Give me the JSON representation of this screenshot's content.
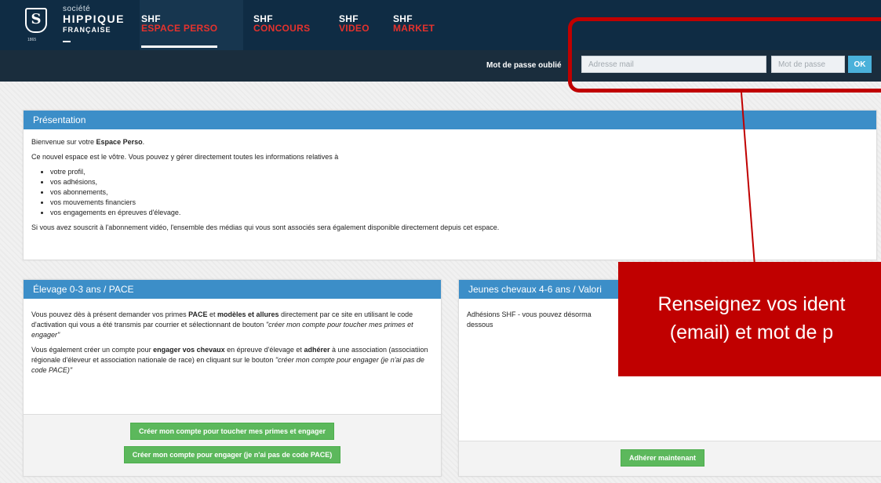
{
  "logo": {
    "line1": "société",
    "line2": "HIPPIQUE",
    "line3": "FRANÇAISE",
    "year": "1865",
    "mark": "S"
  },
  "nav": [
    {
      "top": "SHF",
      "bottom": "ESPACE PERSO",
      "active": true
    },
    {
      "top": "SHF",
      "bottom": "CONCOURS"
    },
    {
      "top": "SHF",
      "bottom": "VIDEO"
    },
    {
      "top": "SHF",
      "bottom": "MARKET"
    }
  ],
  "login": {
    "forgot": "Mot de passe oublié",
    "email_placeholder": "Adresse mail",
    "password_placeholder": "Mot de passe",
    "ok": "OK"
  },
  "callout": {
    "line1": "Renseignez vos ident",
    "line2": "(email) et mot de p"
  },
  "presentation": {
    "title": "Présentation",
    "welcome_pre": "Bienvenue sur votre ",
    "welcome_bold": "Espace Perso",
    "welcome_post": ".",
    "intro": "Ce nouvel espace est le vôtre. Vous pouvez y gérer directement toutes les informations relatives à",
    "items": [
      "votre profil,",
      "vos adhésions,",
      "vos abonnements,",
      "vos mouvements financiers",
      "vos engagements en épreuves d'élevage."
    ],
    "video_note": "Si vous avez souscrit à l'abonnement vidéo, l'ensemble des médias qui vous sont associés sera également disponible directement depuis cet espace."
  },
  "elevage": {
    "title": "Élevage 0-3 ans / PACE",
    "p1_a": "Vous pouvez dès à présent demander vos primes ",
    "p1_b": "PACE",
    "p1_c": " et ",
    "p1_d": "modèles et allures",
    "p1_e": " directement par ce site en utilisant le code d'activation qui vous a été transmis par courrier et sélectionnant de bouton ",
    "p1_f": "\"créer mon compte pour toucher mes primes et engager\"",
    "p2_a": "Vous également créer un compte pour ",
    "p2_b": "engager vos chevaux",
    "p2_c": " en épreuve d'élevage et ",
    "p2_d": "adhérer",
    "p2_e": " à une association (associatiion régionale d'éleveur et association nationale de race) en cliquant sur le bouton ",
    "p2_f": "\"créer mon compte pour engager (je n'ai pas de code PACE)\"",
    "btn1": "Créer mon compte pour toucher mes primes et engager",
    "btn2": "Créer mon compte pour engager (je n'ai pas de code PACE)"
  },
  "jeunes": {
    "title": "Jeunes chevaux 4-6 ans / Valori",
    "text_a": "Adhésions SHF - vous pouvez désorma",
    "text_b": "dessous",
    "btn": "Adhérer maintenant"
  },
  "colors": {
    "nav_bg": "#0f2c44",
    "accent_red": "#e5322d",
    "panel_head": "#3c8ec8",
    "btn_green": "#5cb85c",
    "callout": "#c00000",
    "ok_blue": "#4ab1da"
  }
}
